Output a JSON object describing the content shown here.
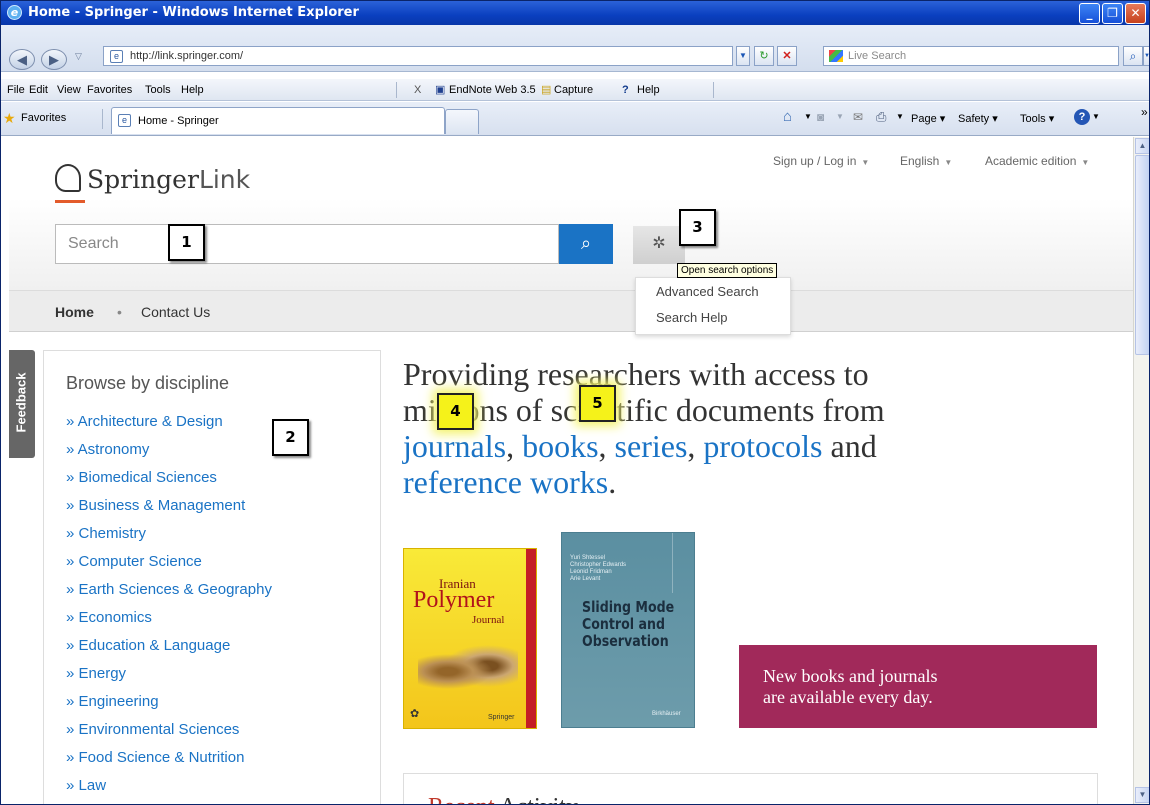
{
  "window": {
    "title": "Home - Springer - Windows Internet Explorer",
    "controls": {
      "minimize": "_",
      "maximize": "❐",
      "close": "✕"
    }
  },
  "address_bar": {
    "url": "http://link.springer.com/",
    "live_search_placeholder": "Live Search"
  },
  "menu": {
    "items": [
      "File",
      "Edit",
      "View",
      "Favorites",
      "Tools",
      "Help"
    ],
    "toolbar": {
      "endnote": "EndNote Web 3.5",
      "capture": "Capture",
      "help": "Help"
    }
  },
  "favorites_bar": {
    "favorites_label": "Favorites",
    "tab_label": "Home - Springer",
    "command_items": [
      "Page",
      "Safety",
      "Tools"
    ]
  },
  "site": {
    "top_links": [
      "Sign up / Log in",
      "English",
      "Academic edition"
    ],
    "logo_brand": "Springer",
    "logo_suffix": "Link",
    "search_placeholder": "Search",
    "nav": {
      "home": "Home",
      "separator": "•",
      "contact": "Contact Us"
    },
    "tooltip": "Open search options",
    "search_options": [
      "Advanced Search",
      "Search Help"
    ],
    "feedback": "Feedback",
    "browse": {
      "title": "Browse by discipline",
      "items": [
        "» Architecture & Design",
        "» Astronomy",
        "» Biomedical Sciences",
        "» Business & Management",
        "» Chemistry",
        "» Computer Science",
        "» Earth Sciences & Geography",
        "» Economics",
        "» Education & Language",
        "» Energy",
        "» Engineering",
        "» Environmental Sciences",
        "» Food Science & Nutrition",
        "» Law"
      ]
    },
    "hero": {
      "line1": "Providing researchers with access to",
      "line2": "millions of scientific documents from",
      "journals": "journals",
      "books": "books",
      "series": "series",
      "protocols": "protocols",
      "and": "and",
      "reference": "reference works",
      "comma": ",",
      "period": "."
    },
    "cover1": {
      "line1": "Iranian",
      "line2": "Polymer",
      "line3": "Journal",
      "publisher": "Springer"
    },
    "cover2": {
      "authors": [
        "Yuri Shtessel",
        "Christopher Edwards",
        "Leonid Fridman",
        "Arie Levant"
      ],
      "title_lines": [
        "Sliding Mode",
        "Control and",
        "Observation"
      ],
      "publisher": "Birkhäuser"
    },
    "promo": {
      "line1": "New books and journals",
      "line2": "are available every day."
    },
    "recent": {
      "part1": "Recent",
      "part2": " Activity"
    }
  },
  "callouts": [
    "1",
    "2",
    "3",
    "4",
    "5"
  ]
}
